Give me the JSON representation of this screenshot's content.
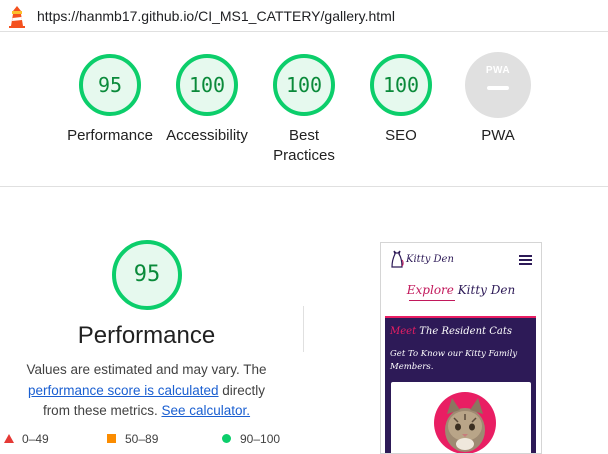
{
  "browser": {
    "url": "https://hanmb17.github.io/CI_MS1_CATTERY/gallery.html"
  },
  "summary": [
    {
      "label": "Performance",
      "score": "95"
    },
    {
      "label": "Accessibility",
      "score": "100"
    },
    {
      "label": "Best",
      "label2": "Practices",
      "score": "100"
    },
    {
      "label": "SEO",
      "score": "100"
    },
    {
      "label": "PWA",
      "badge": "PWA"
    }
  ],
  "colors": {
    "pass": "#0cce6b",
    "pass_text": "#0a8a3a",
    "average": "#fb8c00",
    "fail": "#e53935",
    "na": "#e0e0e0",
    "link": "#1a5fd1"
  },
  "performance": {
    "score": "95",
    "title": "Performance",
    "note_line1": "Values are estimated and may vary. The",
    "note_link": "performance score is calculated",
    "note_after_link": " directly",
    "note_line3": "from these metrics.",
    "calc_link": "See calculator."
  },
  "legend": [
    {
      "label": "0–49"
    },
    {
      "label": "50–89"
    },
    {
      "label": "90–100"
    }
  ],
  "screenshot": {
    "brand": "Kitty Den",
    "heading_first": "Explore",
    "heading_rest": " Kitty Den",
    "band_first": "Meet",
    "band_rest": " The Resident Cats",
    "band_sub": "Get To Know our Kitty Family Members."
  }
}
